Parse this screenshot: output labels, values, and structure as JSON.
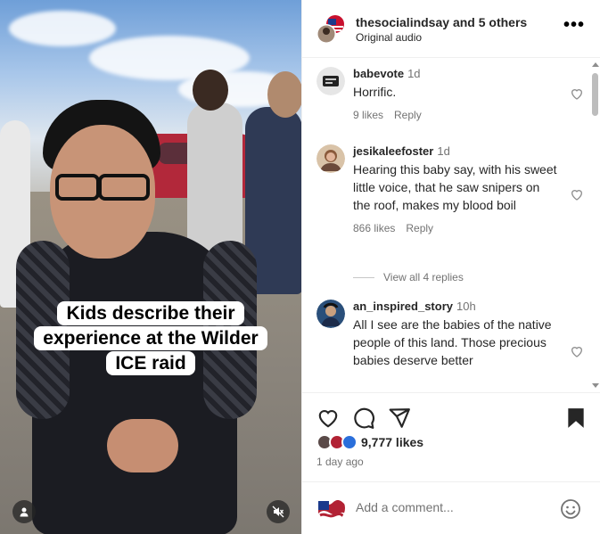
{
  "video": {
    "caption_lines": [
      "Kids describe their",
      "experience at the Wilder",
      "ICE raid"
    ],
    "icons": {
      "profile": "person-icon",
      "sound": "speaker-muted-icon"
    }
  },
  "header": {
    "username": "thesocialindsay",
    "collab_suffix": "and 5 others",
    "audio": "Original audio",
    "more_icon": "more-horizontal-icon"
  },
  "comments": [
    {
      "username": "babevote",
      "time": "1d",
      "text": "Horrific.",
      "likes": "9 likes",
      "reply": "Reply"
    },
    {
      "username": "jesikaleefoster",
      "time": "1d",
      "text": "Hearing this baby say, with his sweet little voice, that he saw snipers on the roof, makes my blood boil",
      "likes": "866 likes",
      "reply": "Reply",
      "view_replies": "View all 4 replies"
    },
    {
      "username": "an_inspired_story",
      "time": "10h",
      "text": "All I see are the babies of the native people of this land. Those precious babies deserve better"
    }
  ],
  "actions": {
    "icons": [
      "heart-icon",
      "comment-icon",
      "share-icon",
      "bookmark-icon"
    ],
    "likes": "9,777 likes",
    "date": "1 day ago"
  },
  "add_comment": {
    "placeholder": "Add a comment...",
    "emoji_icon": "emoji-icon"
  },
  "colors": {
    "text": "#262626",
    "secondary": "#737373",
    "divider": "#efefef"
  }
}
